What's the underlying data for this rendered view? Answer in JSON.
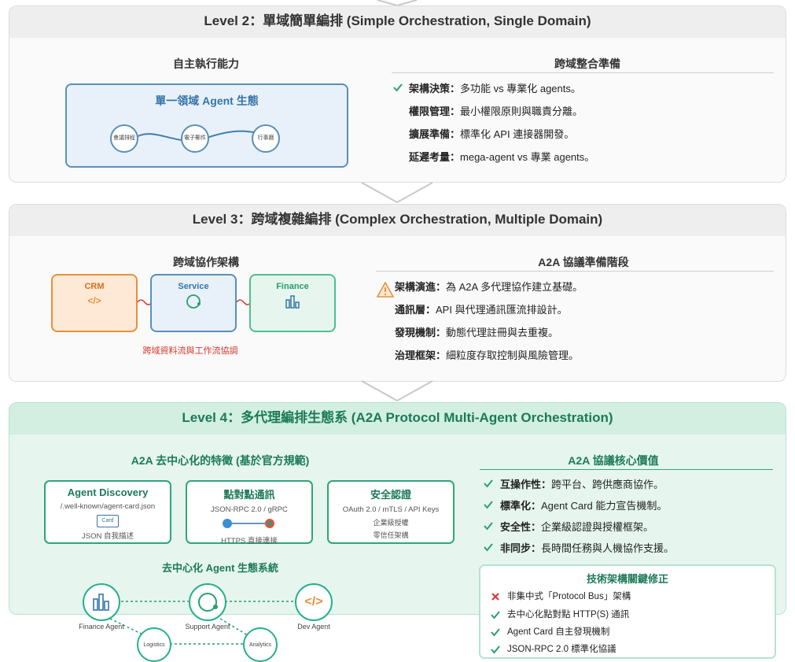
{
  "level2": {
    "title": "Level 2：單域簡單編排 (Simple Orchestration, Single Domain)",
    "left_title": "自主執行能力",
    "domain_box_title": "單一領域 Agent 生態",
    "nodes": [
      "會議排程",
      "電子郵件",
      "行事曆"
    ],
    "right_title": "跨域整合準備",
    "items": [
      {
        "bold": "架構決策：",
        "text": "多功能 vs 專業化 agents。"
      },
      {
        "bold": "權限管理：",
        "text": "最小權限原則與職責分離。"
      },
      {
        "bold": "擴展準備：",
        "text": "標準化 API 連接器開發。"
      },
      {
        "bold": "延遲考量：",
        "text": "mega-agent vs 專業 agents。"
      }
    ]
  },
  "level3": {
    "title": "Level 3：跨域複雜編排 (Complex Orchestration, Multiple Domain)",
    "left_title": "跨域協作架構",
    "boxes": [
      "CRM",
      "Service",
      "Finance"
    ],
    "caption": "跨域資料流與工作流協調",
    "right_title": "A2A 協議準備階段",
    "items": [
      {
        "bold": "架構演進：",
        "text": "為 A2A 多代理協作建立基礎。"
      },
      {
        "bold": "通訊層：",
        "text": "API 與代理通訊匯流排設計。"
      },
      {
        "bold": "發現機制：",
        "text": "動態代理註冊與去重複。"
      },
      {
        "bold": "治理框架：",
        "text": "細粒度存取控制與風險管理。"
      }
    ]
  },
  "level4": {
    "title": "Level 4：多代理編排生態系 (A2A Protocol Multi-Agent Orchestration)",
    "left_title": "A2A 去中心化的特徵 (基於官方規範)",
    "cards": [
      {
        "title": "Agent Discovery",
        "sub": "/.well-known/agent-card.json",
        "badge": "Card",
        "foot": "JSON 自我描述"
      },
      {
        "title": "點對點通訊",
        "sub": "JSON-RPC 2.0 / gRPC",
        "foot": "HTTPS 直接連接"
      },
      {
        "title": "安全認證",
        "sub": "OAuth 2.0 / mTLS / API Keys",
        "line2": "企業級授權",
        "line3": "零信任架構"
      }
    ],
    "eco_title": "去中心化 Agent 生態系統",
    "agents": [
      "Finance Agent",
      "Support Agent",
      "Dev Agent",
      "Logistics",
      "Analytics"
    ],
    "right_title": "A2A 協議核心價值",
    "values": [
      {
        "bold": "互操作性：",
        "text": "跨平台、跨供應商協作。"
      },
      {
        "bold": "標準化：",
        "text": "Agent Card 能力宣告機制。"
      },
      {
        "bold": "安全性：",
        "text": "企業級認證與授權框架。"
      },
      {
        "bold": "非同步：",
        "text": "長時間任務與人機協作支援。"
      }
    ],
    "fix_title": "技術架構關鍵修正",
    "fixes": [
      {
        "text": "非集中式「Protocol Bus」架構",
        "status": "wrong"
      },
      {
        "text": "去中心化點對點 HTTP(S) 通訊",
        "status": "ok"
      },
      {
        "text": "Agent Card 自主發現機制",
        "status": "ok"
      },
      {
        "text": "JSON-RPC 2.0 標準化協議",
        "status": "ok"
      }
    ]
  },
  "colors": {
    "green": "#27a06f",
    "blue_border": "#5a8fb8",
    "orange": "#e8913a",
    "red_x": "#d9342b"
  }
}
